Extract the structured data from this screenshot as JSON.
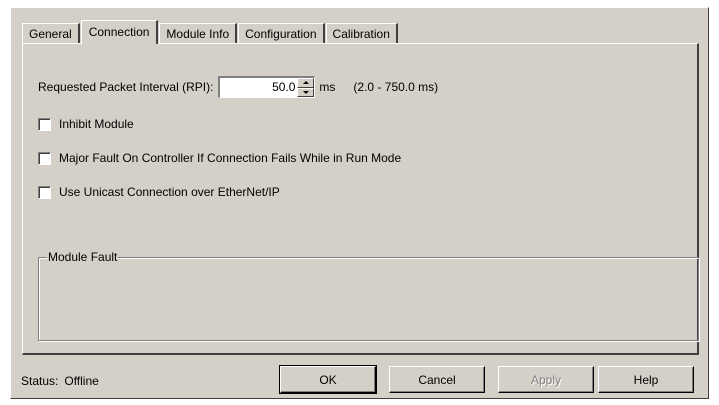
{
  "tabs": [
    {
      "label": "General"
    },
    {
      "label": "Connection"
    },
    {
      "label": "Module Info"
    },
    {
      "label": "Configuration"
    },
    {
      "label": "Calibration"
    }
  ],
  "active_tab": "Connection",
  "rpi": {
    "label": "Requested Packet Interval (RPI):",
    "value": "50.0",
    "units": "ms",
    "range": "(2.0 - 750.0 ms)"
  },
  "options": {
    "inhibit_module": {
      "label": "Inhibit Module",
      "checked": false
    },
    "major_fault": {
      "label": "Major Fault On Controller If Connection Fails While in Run Mode",
      "checked": false
    },
    "unicast": {
      "label": "Use Unicast Connection over EtherNet/IP",
      "checked": false
    }
  },
  "module_fault": {
    "title": "Module Fault",
    "text": ""
  },
  "status": {
    "label": "Status:",
    "value": "Offline"
  },
  "buttons": {
    "ok": "OK",
    "cancel": "Cancel",
    "apply": "Apply",
    "help": "Help"
  },
  "colors": {
    "face": "#d4d0c8",
    "highlight": "#ffffff",
    "shadow": "#808080",
    "dark_shadow": "#404040",
    "disabled_text": "#808080"
  }
}
